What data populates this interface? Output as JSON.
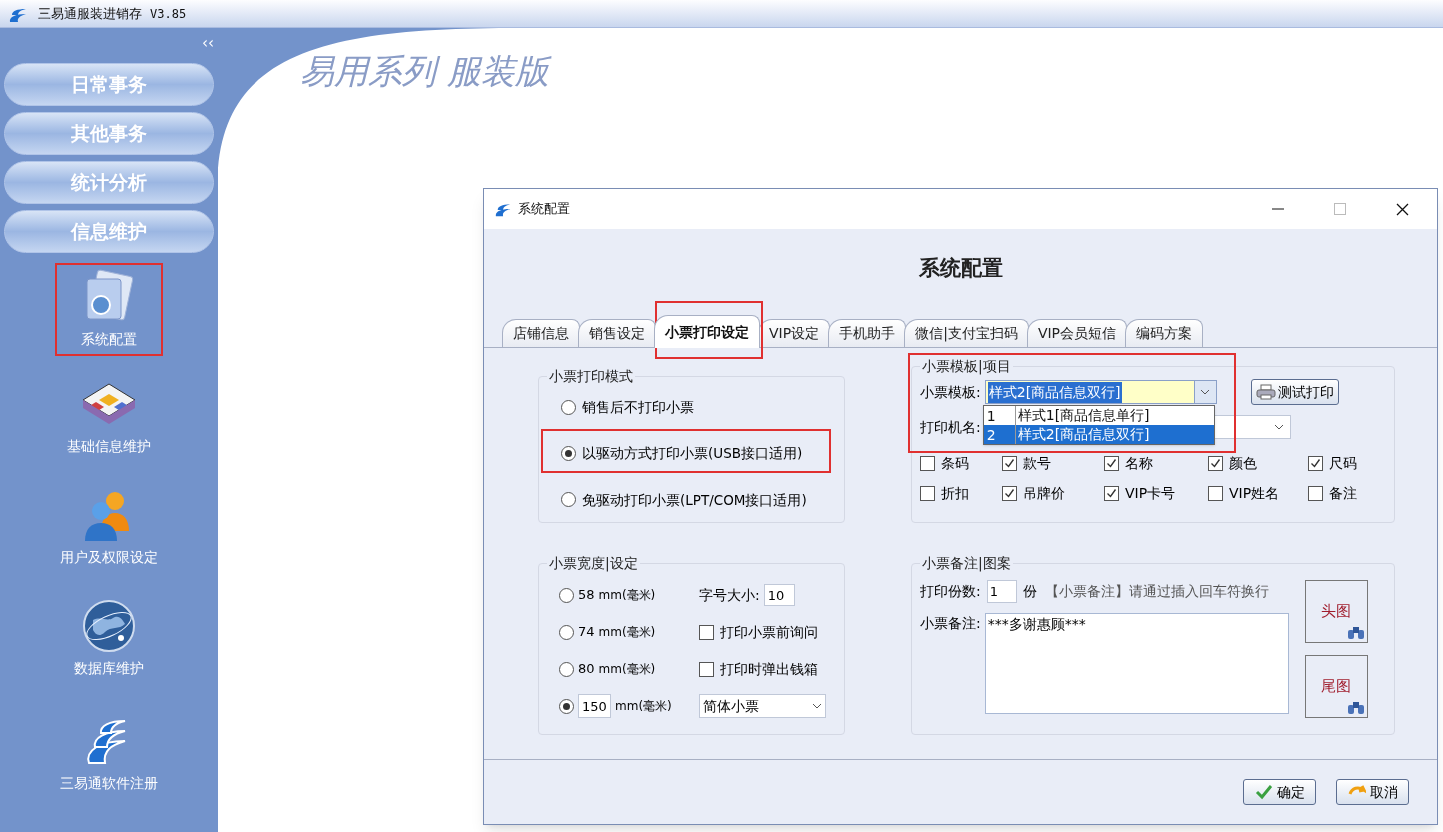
{
  "app": {
    "title": "三易通服装进销存",
    "version": "V3.85",
    "collapse": "‹‹",
    "banner": "易用系列 服装版"
  },
  "nav_buttons": [
    "日常事务",
    "其他事务",
    "统计分析",
    "信息维护"
  ],
  "sidebar_items": [
    {
      "label": "系统配置",
      "kind": "folder",
      "selected": true
    },
    {
      "label": "基础信息维护",
      "kind": "cubes",
      "selected": false
    },
    {
      "label": "用户及权限设定",
      "kind": "users",
      "selected": false
    },
    {
      "label": "数据库维护",
      "kind": "globe",
      "selected": false
    },
    {
      "label": "三易通软件注册",
      "kind": "logo",
      "selected": false
    }
  ],
  "dialog": {
    "title": "系统配置",
    "heading": "系统配置",
    "tabs": [
      {
        "label": "店铺信息",
        "selected": false
      },
      {
        "label": "销售设定",
        "selected": false
      },
      {
        "label": "小票打印设定",
        "selected": true
      },
      {
        "label": "VIP设定",
        "selected": false
      },
      {
        "label": "手机助手",
        "selected": false
      },
      {
        "label": "微信|支付宝扫码",
        "selected": false
      },
      {
        "label": "VIP会员短信",
        "selected": false
      },
      {
        "label": "编码方案",
        "selected": false
      }
    ],
    "print_mode": {
      "title": "小票打印模式",
      "options": [
        {
          "label": "销售后不打印小票",
          "selected": false
        },
        {
          "label": "以驱动方式打印小票(USB接口适用)",
          "selected": true
        },
        {
          "label": "免驱动打印小票(LPT/COM接口适用)",
          "selected": false
        }
      ]
    },
    "width": {
      "title": "小票宽度|设定",
      "options": [
        {
          "kind": "fixed",
          "value": "58",
          "unit": "mm(毫米)",
          "selected": false
        },
        {
          "kind": "fixed",
          "value": "74",
          "unit": "mm(毫米)",
          "selected": false
        },
        {
          "kind": "fixed",
          "value": "80",
          "unit": "mm(毫米)",
          "selected": false
        },
        {
          "kind": "custom",
          "value": "150",
          "unit": "mm(毫米)",
          "selected": true
        }
      ],
      "settings": [
        {
          "kind": "field",
          "label": "字号大小:",
          "value": "10"
        },
        {
          "kind": "checkbox",
          "label": "打印小票前询问",
          "checked": false
        },
        {
          "kind": "checkbox",
          "label": "打印时弹出钱箱",
          "checked": false
        },
        {
          "kind": "select",
          "value": "简体小票"
        }
      ]
    },
    "template": {
      "title": "小票模板|项目",
      "template_label": "小票模板:",
      "template_value": "样式2[商品信息双行]",
      "test_button": "测试打印",
      "printer_label": "打印机名:",
      "dropdown": [
        {
          "number": "1",
          "label": "样式1[商品信息单行]",
          "selected": false
        },
        {
          "number": "2",
          "label": "样式2[商品信息双行]",
          "selected": true
        }
      ],
      "items": [
        {
          "label": "条码",
          "checked": false
        },
        {
          "label": "款号",
          "checked": true
        },
        {
          "label": "名称",
          "checked": true
        },
        {
          "label": "颜色",
          "checked": true
        },
        {
          "label": "尺码",
          "checked": true
        },
        {
          "label": "折扣",
          "checked": false
        },
        {
          "label": "吊牌价",
          "checked": true
        },
        {
          "label": "VIP卡号",
          "checked": true
        },
        {
          "label": "VIP姓名",
          "checked": false
        },
        {
          "label": "备注",
          "checked": false
        }
      ]
    },
    "notes": {
      "title": "小票备注|图案",
      "copies_label": "打印份数:",
      "copies": "1",
      "copies_unit": "份",
      "hint": "【小票备注】请通过插入回车符换行",
      "note_label": "小票备注:",
      "note": "***多谢惠顾***",
      "header_image": "头图",
      "footer_image": "尾图"
    },
    "ok": "确定",
    "cancel": "取消"
  }
}
